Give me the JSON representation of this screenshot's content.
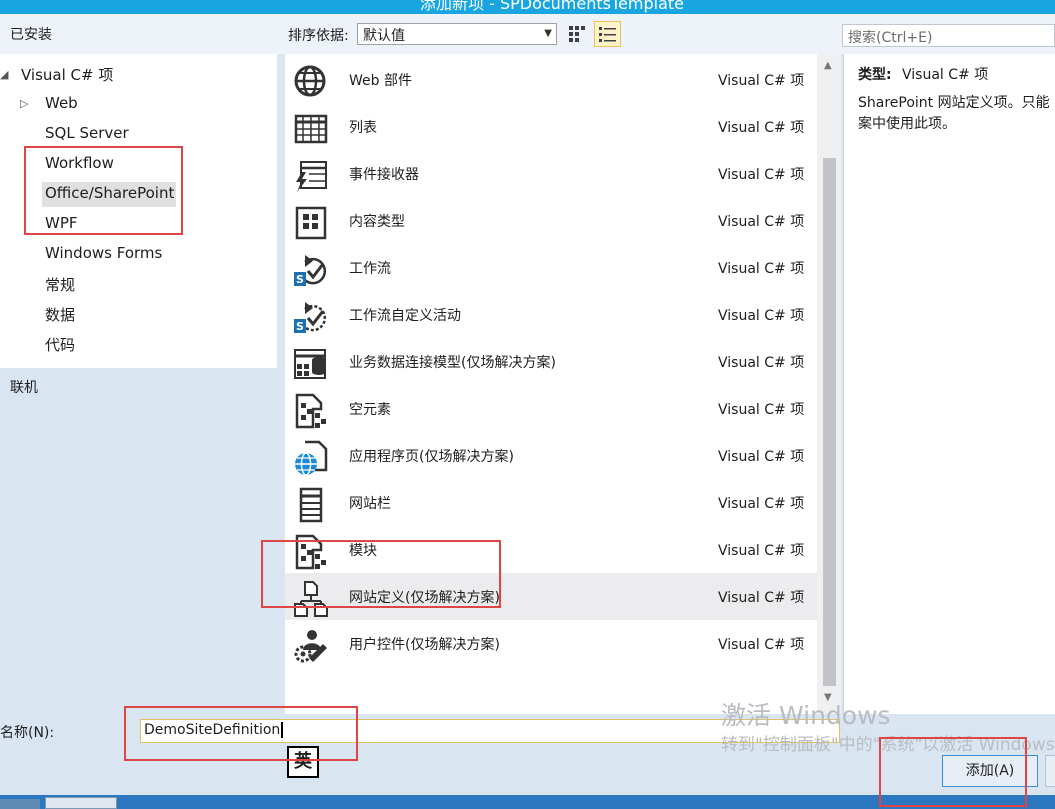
{
  "window": {
    "title": "添加新项 - SPDocumentsTemplate"
  },
  "toolbar": {
    "installed_label": "已安装",
    "sort_label": "排序依据:",
    "sort_value": "默认值",
    "search_placeholder": "搜索(Ctrl+E)"
  },
  "tree": {
    "root": "Visual C# 项",
    "items": [
      {
        "label": "Web"
      },
      {
        "label": "SQL Server"
      },
      {
        "label": "Workflow"
      },
      {
        "label": "Office/SharePoint"
      },
      {
        "label": "WPF"
      },
      {
        "label": "Windows Forms"
      },
      {
        "label": "常规"
      },
      {
        "label": "数据"
      },
      {
        "label": "代码"
      }
    ],
    "online": "联机"
  },
  "templates": [
    {
      "name": "Web 部件",
      "type": "Visual C# 项",
      "icon": "globe-icon"
    },
    {
      "name": "列表",
      "type": "Visual C# 项",
      "icon": "list-table-icon"
    },
    {
      "name": "事件接收器",
      "type": "Visual C# 项",
      "icon": "event-receiver-icon"
    },
    {
      "name": "内容类型",
      "type": "Visual C# 项",
      "icon": "content-type-icon"
    },
    {
      "name": "工作流",
      "type": "Visual C# 项",
      "icon": "workflow-icon"
    },
    {
      "name": "工作流自定义活动",
      "type": "Visual C# 项",
      "icon": "workflow-activity-icon"
    },
    {
      "name": "业务数据连接模型(仅场解决方案)",
      "type": "Visual C# 项",
      "icon": "bdc-model-icon"
    },
    {
      "name": "空元素",
      "type": "Visual C# 项",
      "icon": "empty-element-icon"
    },
    {
      "name": "应用程序页(仅场解决方案)",
      "type": "Visual C# 项",
      "icon": "application-page-icon"
    },
    {
      "name": "网站栏",
      "type": "Visual C# 项",
      "icon": "site-column-icon"
    },
    {
      "name": "模块",
      "type": "Visual C# 项",
      "icon": "module-icon"
    },
    {
      "name": "网站定义(仅场解决方案)",
      "type": "Visual C# 项",
      "icon": "site-definition-icon"
    },
    {
      "name": "用户控件(仅场解决方案)",
      "type": "Visual C# 项",
      "icon": "user-control-icon"
    }
  ],
  "details": {
    "type_label": "类型:",
    "type_value": "Visual C# 项",
    "description": "SharePoint 网站定义项。只能\n案中使用此项。"
  },
  "bottom": {
    "name_label": "名称(N):",
    "name_value": "DemoSiteDefinition",
    "ime_indicator": "英",
    "add_label": "添加(A)"
  },
  "watermark": {
    "line1": "激活 Windows",
    "line2": "转到\"控制面板\"中的\"系统\"以激活 Windows。"
  },
  "colors": {
    "accent": "#19a6e0",
    "annotation": "#e04545",
    "selection": "#ececee"
  }
}
